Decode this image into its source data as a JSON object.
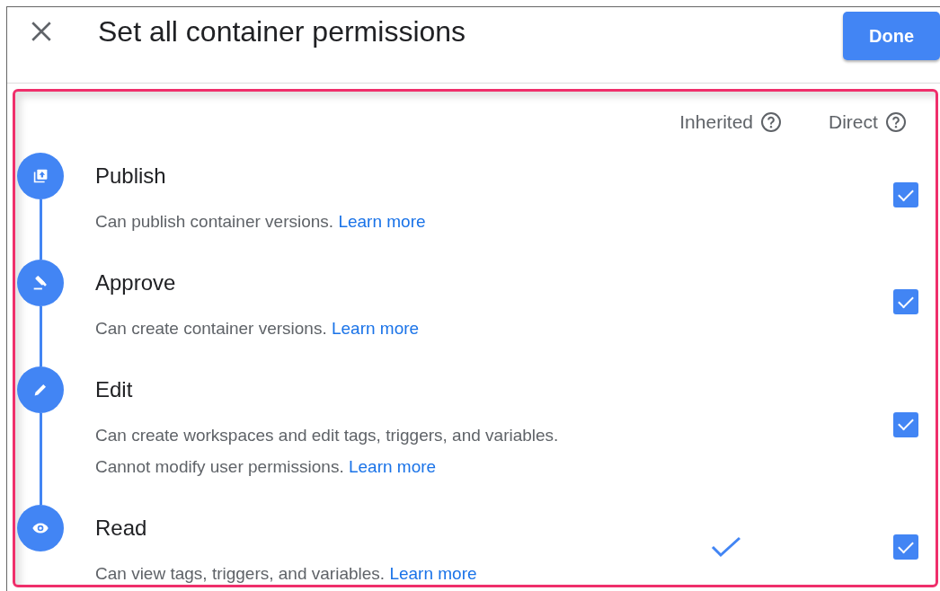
{
  "dialog": {
    "title": "Set all container permissions",
    "done_button": "Done"
  },
  "columns": [
    {
      "label": "Inherited"
    },
    {
      "label": "Direct"
    }
  ],
  "permissions": [
    {
      "kind": "publish",
      "title": "Publish",
      "description": "Can publish container versions.",
      "link": "Learn more",
      "inherited": false,
      "direct": true
    },
    {
      "kind": "approve",
      "title": "Approve",
      "description": "Can create container versions.",
      "link": "Learn more",
      "inherited": false,
      "direct": true
    },
    {
      "kind": "edit",
      "title": "Edit",
      "description": "Can create workspaces and edit tags, triggers, and variables. Cannot modify user permissions.",
      "link": "Learn more",
      "inherited": false,
      "direct": true
    },
    {
      "kind": "read",
      "title": "Read",
      "description": "Can view tags, triggers, and variables.",
      "link": "Learn more",
      "inherited": true,
      "direct": true
    }
  ]
}
